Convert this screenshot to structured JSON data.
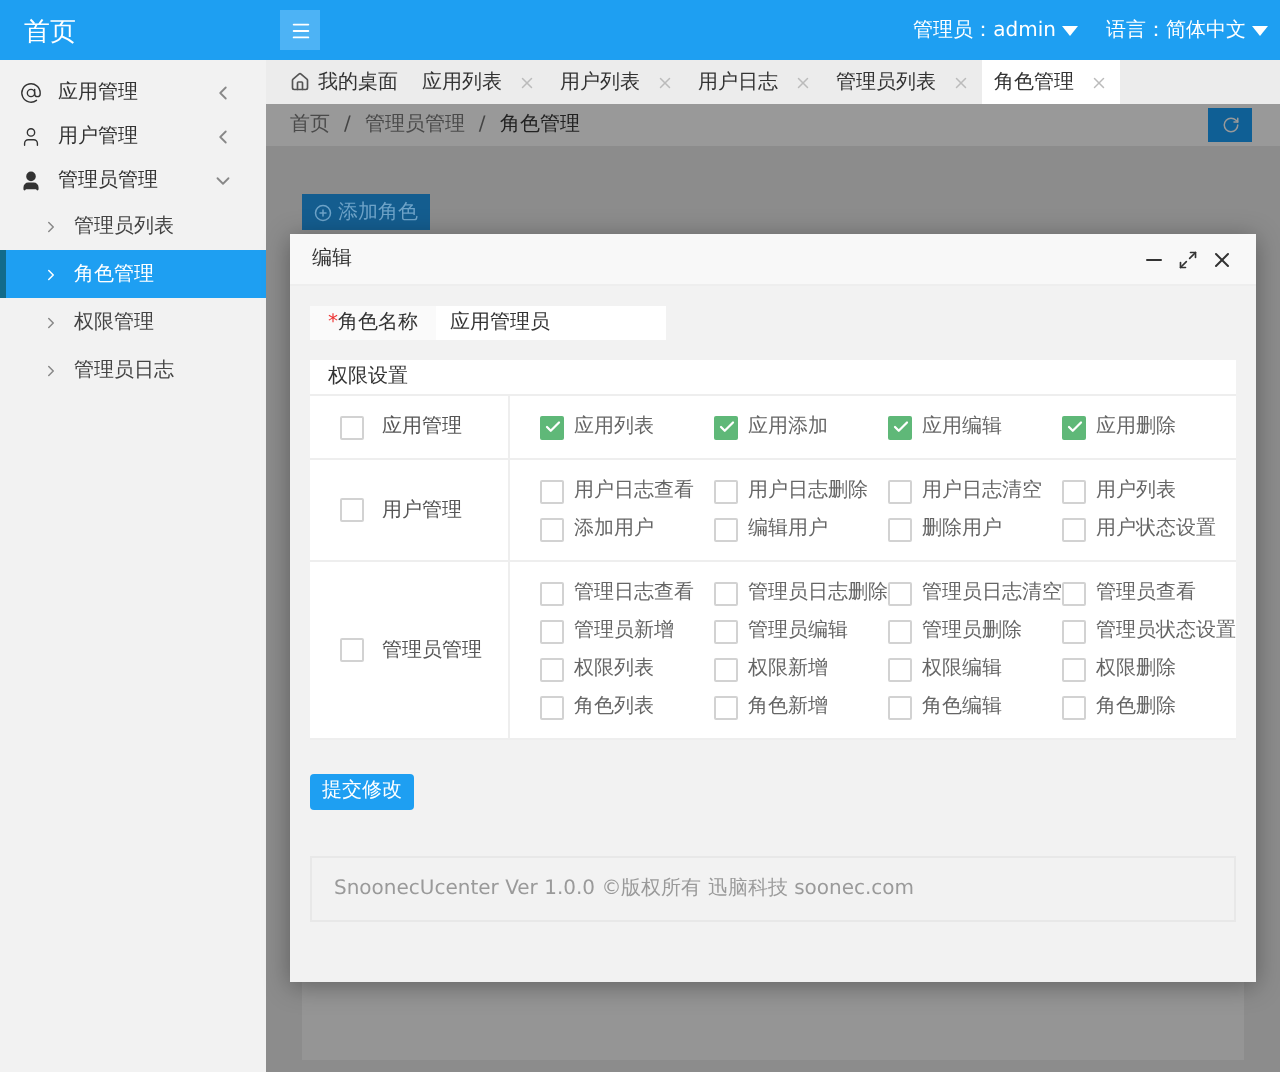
{
  "header": {
    "title": "首页",
    "admin": "管理员：admin",
    "language": "语言：简体中文"
  },
  "sidebar": {
    "items": [
      {
        "label": "应用管理",
        "expanded": false
      },
      {
        "label": "用户管理",
        "expanded": false
      },
      {
        "label": "管理员管理",
        "expanded": true,
        "children": [
          {
            "label": "管理员列表",
            "selected": false
          },
          {
            "label": "角色管理",
            "selected": true
          },
          {
            "label": "权限管理",
            "selected": false
          },
          {
            "label": "管理员日志",
            "selected": false
          }
        ]
      }
    ]
  },
  "tabs": [
    {
      "kind": "home",
      "label": "我的桌面",
      "selected": false
    },
    {
      "kind": "closable",
      "label": "应用列表",
      "selected": false
    },
    {
      "kind": "closable",
      "label": "用户列表",
      "selected": false
    },
    {
      "kind": "closable",
      "label": "用户日志",
      "selected": false
    },
    {
      "kind": "closable",
      "label": "管理员列表",
      "selected": false
    },
    {
      "kind": "closable",
      "label": "角色管理",
      "selected": true
    }
  ],
  "breadcrumb": [
    {
      "kind": "link",
      "text": "首页"
    },
    {
      "kind": "separator",
      "text": "/"
    },
    {
      "kind": "link",
      "text": "管理员管理"
    },
    {
      "kind": "separator",
      "text": "/"
    },
    {
      "kind": "current",
      "text": "角色管理"
    }
  ],
  "add_button": "添加角色",
  "dialog": {
    "title": "编辑",
    "role_field": {
      "label": "角色名称",
      "required_mark": "*",
      "value": "应用管理员"
    },
    "permissions": {
      "title": "权限设置",
      "groups": [
        {
          "label": "应用管理",
          "checked": false,
          "items": [
            {
              "label": "应用列表",
              "checked": true
            },
            {
              "label": "应用添加",
              "checked": true
            },
            {
              "label": "应用编辑",
              "checked": true
            },
            {
              "label": "应用删除",
              "checked": true
            }
          ]
        },
        {
          "label": "用户管理",
          "checked": false,
          "items": [
            {
              "label": "用户日志查看",
              "checked": false
            },
            {
              "label": "用户日志删除",
              "checked": false
            },
            {
              "label": "用户日志清空",
              "checked": false
            },
            {
              "label": "用户列表",
              "checked": false
            },
            {
              "label": "添加用户",
              "checked": false
            },
            {
              "label": "编辑用户",
              "checked": false
            },
            {
              "label": "删除用户",
              "checked": false
            },
            {
              "label": "用户状态设置",
              "checked": false
            }
          ]
        },
        {
          "label": "管理员管理",
          "checked": false,
          "items": [
            {
              "label": "管理日志查看",
              "checked": false
            },
            {
              "label": "管理员日志删除",
              "checked": false
            },
            {
              "label": "管理员日志清空",
              "checked": false
            },
            {
              "label": "管理员查看",
              "checked": false
            },
            {
              "label": "管理员新增",
              "checked": false
            },
            {
              "label": "管理员编辑",
              "checked": false
            },
            {
              "label": "管理员删除",
              "checked": false
            },
            {
              "label": "管理员状态设置",
              "checked": false
            },
            {
              "label": "权限列表",
              "checked": false
            },
            {
              "label": "权限新增",
              "checked": false
            },
            {
              "label": "权限编辑",
              "checked": false
            },
            {
              "label": "权限删除",
              "checked": false
            },
            {
              "label": "角色列表",
              "checked": false
            },
            {
              "label": "角色新增",
              "checked": false
            },
            {
              "label": "角色编辑",
              "checked": false
            },
            {
              "label": "角色删除",
              "checked": false
            }
          ]
        }
      ]
    },
    "submit": "提交修改",
    "footer": "SnoonecUcenter Ver 1.0.0 ©版权所有 迅脑科技 soonec.com"
  }
}
